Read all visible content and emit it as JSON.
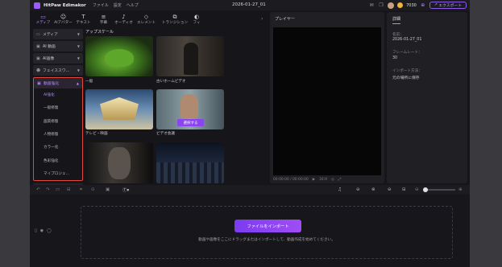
{
  "app": {
    "name": "HitPaw Edimakor",
    "menu": [
      "ファイル",
      "設定",
      "ヘルプ"
    ],
    "document_title": "2026-01-27_01",
    "credits": "7030",
    "export_label": "エクスポート"
  },
  "toolbar": {
    "tools": [
      {
        "label": "メディア",
        "icon": "media-icon",
        "glyph": "▭",
        "active": true
      },
      {
        "label": "AIアバター",
        "icon": "ai-avatar-icon",
        "glyph": "☺",
        "active": false
      },
      {
        "label": "テキスト",
        "icon": "text-icon",
        "glyph": "T",
        "active": false
      },
      {
        "label": "字幕",
        "icon": "subtitle-icon",
        "glyph": "≡",
        "active": false
      },
      {
        "label": "オーディオ",
        "icon": "audio-icon",
        "glyph": "♪",
        "active": false
      },
      {
        "label": "エレメント",
        "icon": "element-icon",
        "glyph": "◇",
        "active": false
      },
      {
        "label": "トランジション",
        "icon": "transition-icon",
        "glyph": "⧉",
        "active": false
      },
      {
        "label": "フィ",
        "icon": "filter-icon",
        "glyph": "◐",
        "active": false
      }
    ]
  },
  "sidebar": {
    "items": [
      {
        "label": "メディア",
        "icon": "folder-icon"
      },
      {
        "label": "AI 動画",
        "icon": "ai-video-icon"
      },
      {
        "label": "AI画像",
        "icon": "ai-image-icon"
      },
      {
        "label": "フェイススワ...",
        "icon": "face-swap-icon"
      }
    ],
    "enhance": {
      "label": "動画強化",
      "icon": "enhance-icon",
      "sub_items": [
        "AI強化",
        "一般修復",
        "画質修復",
        "人物修復",
        "カラー化",
        "色彩強化",
        "マイプロジェ..."
      ]
    }
  },
  "library": {
    "section_title": "アップスケール",
    "cards": [
      {
        "label": "一般",
        "thumb": "frog"
      },
      {
        "label": "古いホームビデオ",
        "thumb": "oldvideo"
      },
      {
        "label": "テレビ・映画",
        "thumb": "fox"
      },
      {
        "label": "ビデオ会議",
        "thumb": "meeting"
      },
      {
        "label": "",
        "thumb": "face"
      },
      {
        "label": "",
        "thumb": "city"
      }
    ],
    "select_label": "選択する"
  },
  "player": {
    "title": "プレイヤー",
    "time": "00:00:00 / 00:00:00",
    "ratio": "16:9"
  },
  "details": {
    "tab": "詳細",
    "name_label": "名前：",
    "name_value": "2026-01-27_01",
    "fps_label": "フレームレート：",
    "fps_value": "30",
    "import_label": "インポート方法：",
    "import_value": "元の場所に保存"
  },
  "timeline": {
    "import_button": "ファイルをインポート",
    "hint": "動画や画像をここにドラッグまたはインポートして、動画作成を始めてください。"
  }
}
